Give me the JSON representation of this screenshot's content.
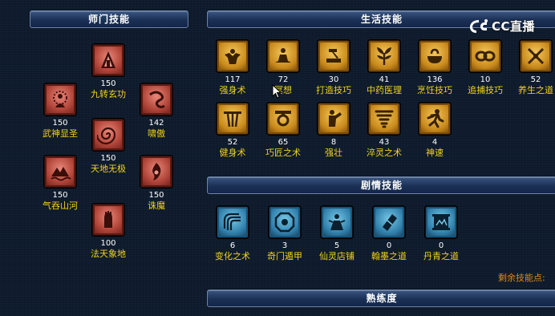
{
  "headers": {
    "school": "师门技能",
    "life": "生活技能",
    "plot": "剧情技能",
    "proficiency": "熟练度"
  },
  "school_skills": [
    {
      "value": "150",
      "name": "九转玄功"
    },
    {
      "value": "150",
      "name": "武神显圣"
    },
    {
      "value": "142",
      "name": "啸傲"
    },
    {
      "value": "150",
      "name": "天地无极"
    },
    {
      "value": "150",
      "name": "气吞山河"
    },
    {
      "value": "150",
      "name": "诛魔"
    },
    {
      "value": "100",
      "name": "法天象地"
    }
  ],
  "life_skills": [
    {
      "value": "117",
      "name": "强身术"
    },
    {
      "value": "72",
      "name": "冥想"
    },
    {
      "value": "30",
      "name": "打造技巧"
    },
    {
      "value": "41",
      "name": "中药医理"
    },
    {
      "value": "136",
      "name": "烹饪技巧"
    },
    {
      "value": "10",
      "name": "追捕技巧"
    },
    {
      "value": "52",
      "name": "养生之道"
    },
    {
      "value": "52",
      "name": "健身术"
    },
    {
      "value": "65",
      "name": "巧匠之术"
    },
    {
      "value": "8",
      "name": "强壮"
    },
    {
      "value": "43",
      "name": "淬灵之术"
    },
    {
      "value": "4",
      "name": "神速"
    }
  ],
  "plot_skills": [
    {
      "value": "6",
      "name": "变化之术"
    },
    {
      "value": "3",
      "name": "奇门遁甲"
    },
    {
      "value": "5",
      "name": "仙灵店铺"
    },
    {
      "value": "0",
      "name": "翰墨之道"
    },
    {
      "value": "0",
      "name": "丹青之道"
    }
  ],
  "remaining_points_label": "剩余技能点:",
  "watermark": "CC直播",
  "colors": {
    "skill_name": "#f2d21b",
    "skill_value": "#ffffff",
    "remaining": "#e0881c",
    "header_bg": "#1b3055"
  }
}
